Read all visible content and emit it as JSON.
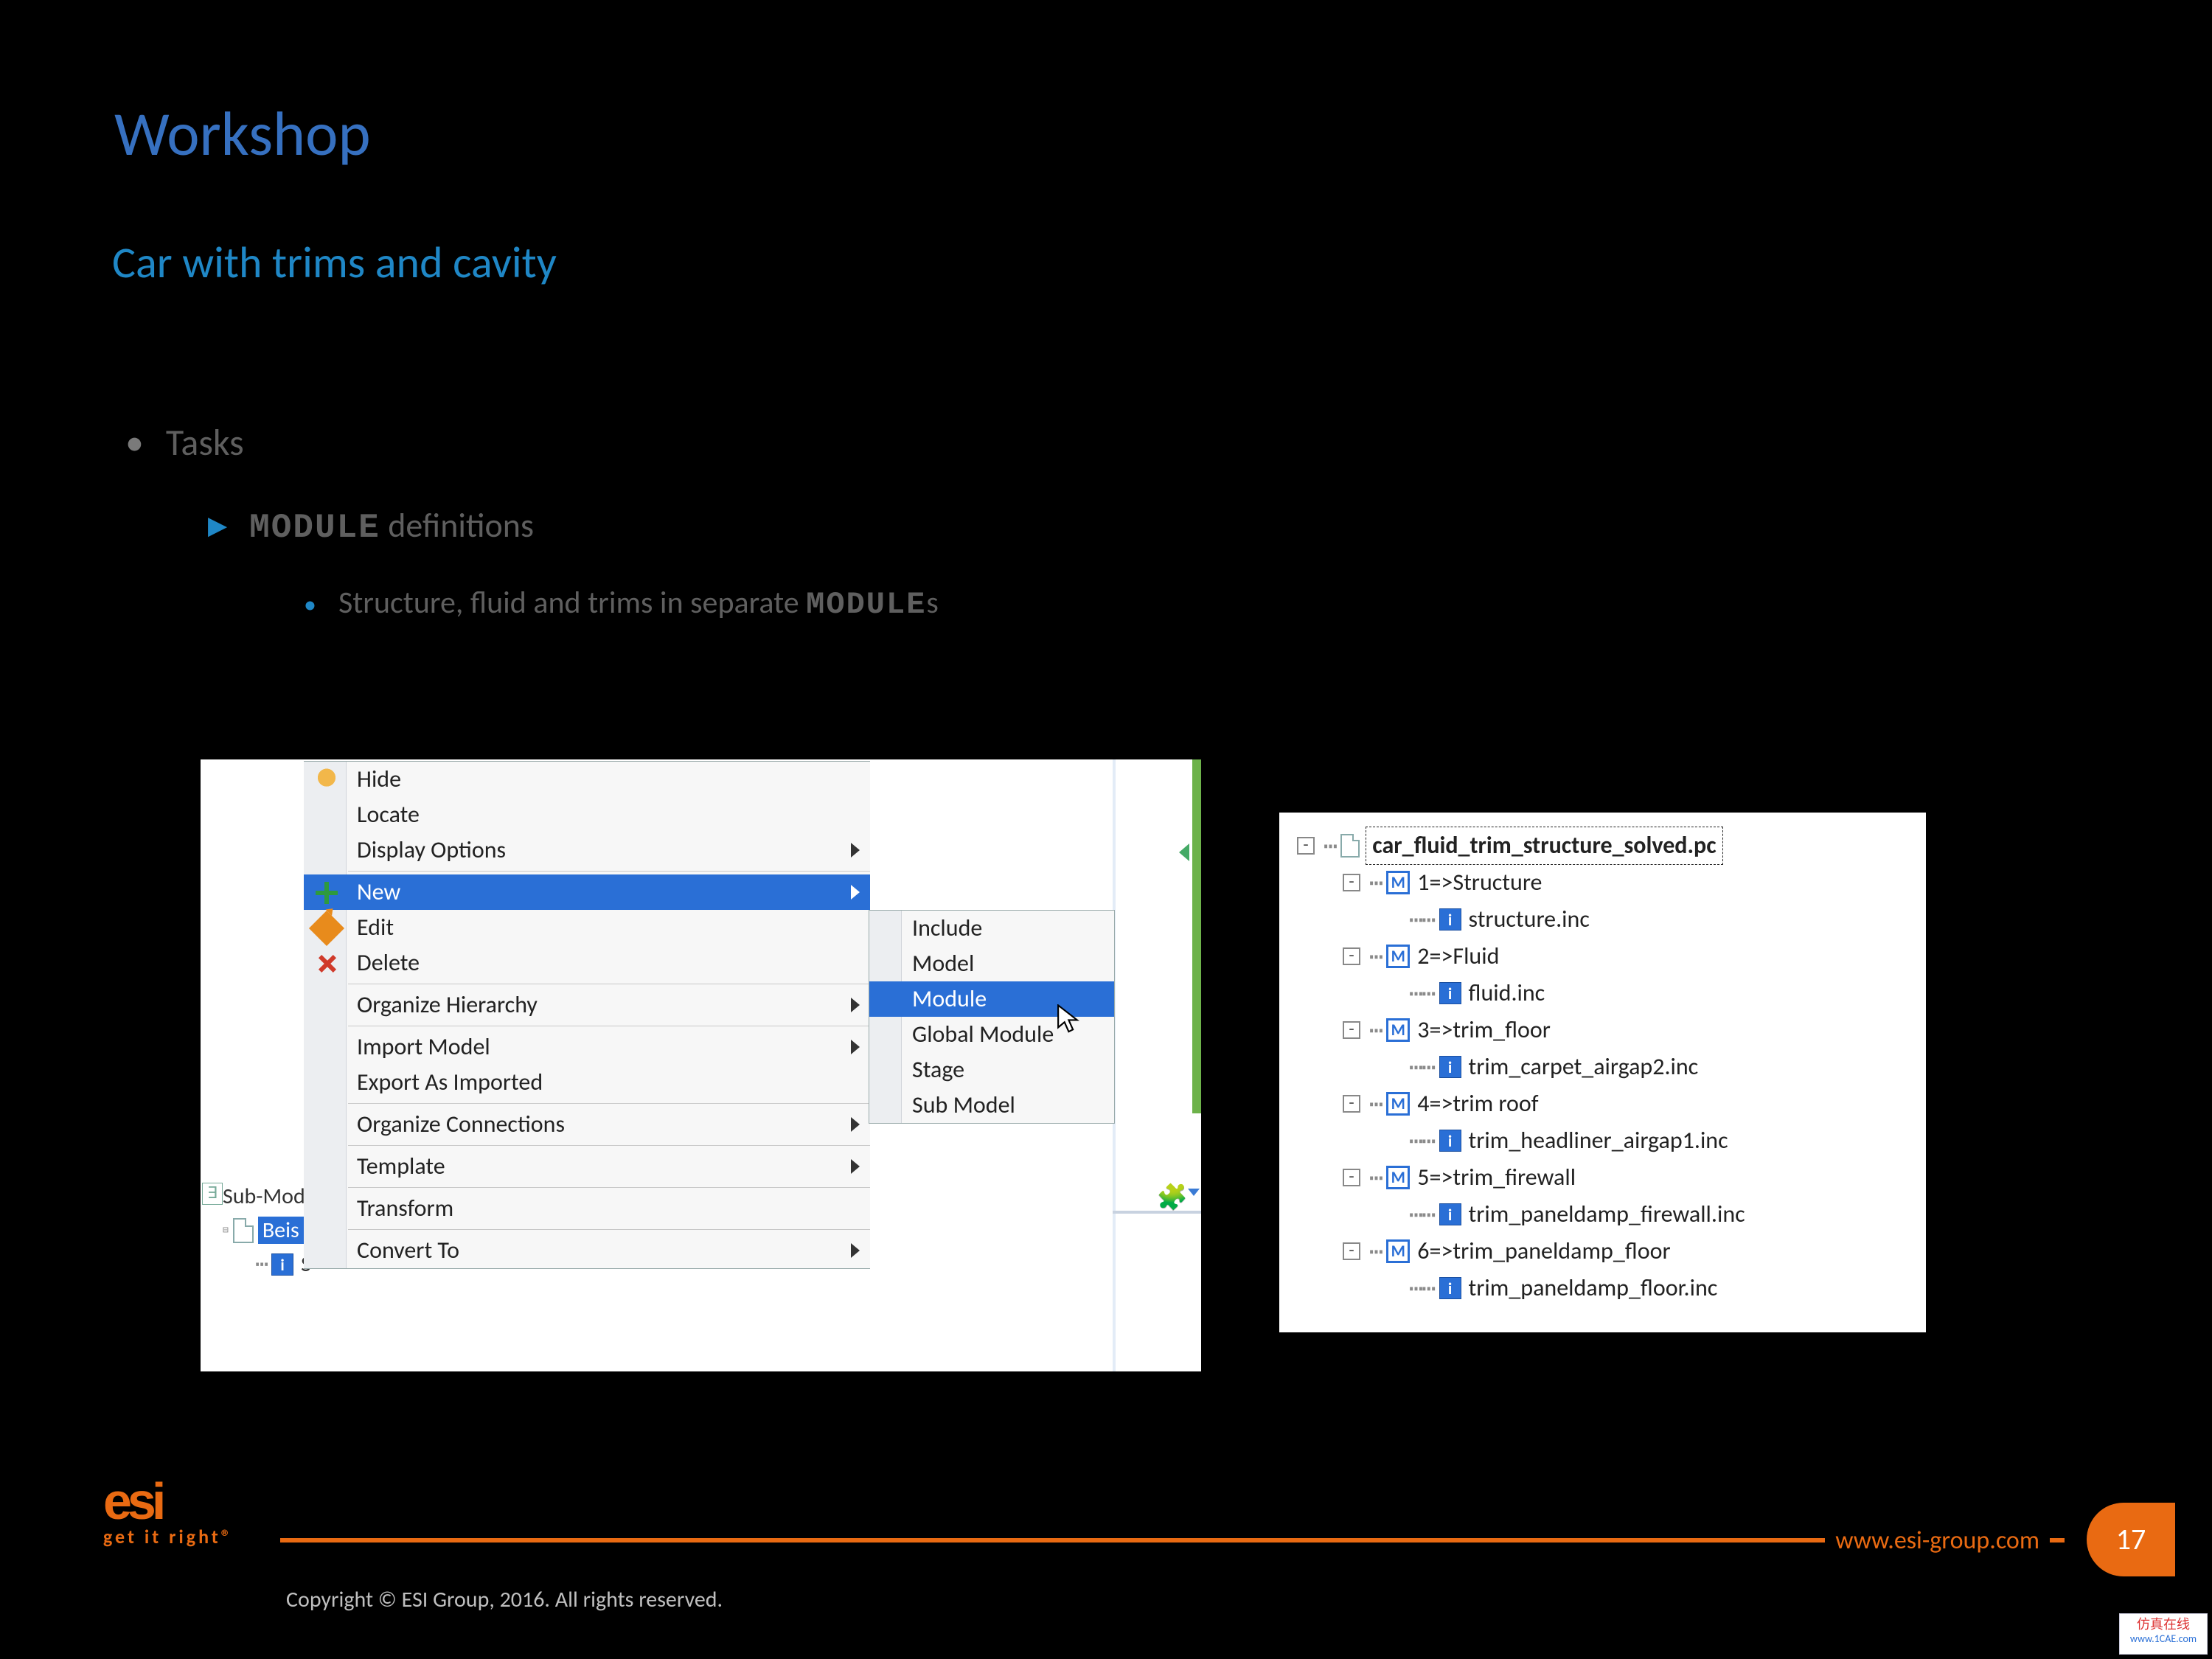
{
  "title": "Workshop",
  "subtitle": "Car with trims and cavity",
  "bullets": {
    "l1": "Tasks",
    "l2_mono": "MODULE",
    "l2_rest": "  definitions",
    "l3_pre": "Structure, fluid and trims in separate ",
    "l3_mono": "MODULE",
    "l3_suf": "s"
  },
  "panelA": {
    "sidebar_label": "Sub-Mod",
    "selected_node": "Beis",
    "child_node": "S",
    "context_menu": [
      {
        "label": "Hide",
        "icon": "hide-icon"
      },
      {
        "label": "Locate"
      },
      {
        "label": "Display Options",
        "submenu": true,
        "sep_after": true
      },
      {
        "label": "New",
        "icon": "plus-icon",
        "submenu": true,
        "highlight": true
      },
      {
        "label": "Edit",
        "icon": "edit-icon"
      },
      {
        "label": "Delete",
        "icon": "delete-icon",
        "sep_after": true
      },
      {
        "label": "Organize Hierarchy",
        "submenu": true,
        "sep_after": true
      },
      {
        "label": "Import Model",
        "submenu": true
      },
      {
        "label": "Export As Imported",
        "sep_after": true
      },
      {
        "label": "Organize Connections",
        "submenu": true,
        "sep_after": true
      },
      {
        "label": "Template",
        "submenu": true,
        "sep_after": true
      },
      {
        "label": "Transform",
        "sep_after": true
      },
      {
        "label": "Convert To",
        "submenu": true
      }
    ],
    "submenu": [
      {
        "label": "Include"
      },
      {
        "label": "Model"
      },
      {
        "label": "Module",
        "highlight": true
      },
      {
        "label": "Global Module"
      },
      {
        "label": "Stage"
      },
      {
        "label": "Sub Model"
      }
    ]
  },
  "panelB": {
    "root": "car_fluid_trim_structure_solved.pc",
    "modules": [
      {
        "label": "1=>Structure",
        "child": "structure.inc"
      },
      {
        "label": "2=>Fluid",
        "child": "fluid.inc"
      },
      {
        "label": "3=>trim_floor",
        "child": "trim_carpet_airgap2.inc"
      },
      {
        "label": "4=>trim roof",
        "child": "trim_headliner_airgap1.inc"
      },
      {
        "label": "5=>trim_firewall",
        "child": "trim_paneldamp_firewall.inc"
      },
      {
        "label": "6=>trim_paneldamp_floor",
        "child": "trim_paneldamp_floor.inc"
      }
    ]
  },
  "footer": {
    "logo_main": "esi",
    "logo_tag": "get it right®",
    "url": "www.esi-group.com",
    "page": "17",
    "copyright": "Copyright © ESI Group, 2016. All rights reserved."
  },
  "watermark": {
    "line1": "仿真在线",
    "line2": "www.1CAE.com"
  }
}
